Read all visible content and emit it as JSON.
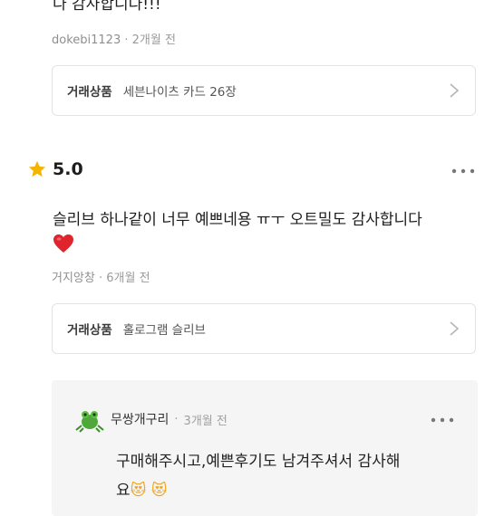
{
  "review_prev": {
    "text_tail": "다 감사합니다!!!",
    "author": "dokebi1123",
    "time": "2개월 전",
    "product_label": "거래상품",
    "product_name": "세븐나이츠 카드 26장"
  },
  "review": {
    "rating": "5.0",
    "text": "슬리브 하나같이 너무 예쁘네용 ㅠㅜ 오트밀도 감사합니다",
    "emoji": "❤️",
    "author": "거지앙창",
    "time": "6개월 전",
    "product_label": "거래상품",
    "product_name": "홀로그램 슬리브"
  },
  "reply": {
    "author": "무쌍개구리",
    "time": "3개월 전",
    "text_line1": "구매해주시고,예쁜후기도 남겨주셔서 감사해",
    "text_line2": "요",
    "emoji": "😻 😻"
  },
  "colors": {
    "star": "#f5b400",
    "heart": "#e0242d",
    "reply_bg": "#f5f5f5"
  }
}
